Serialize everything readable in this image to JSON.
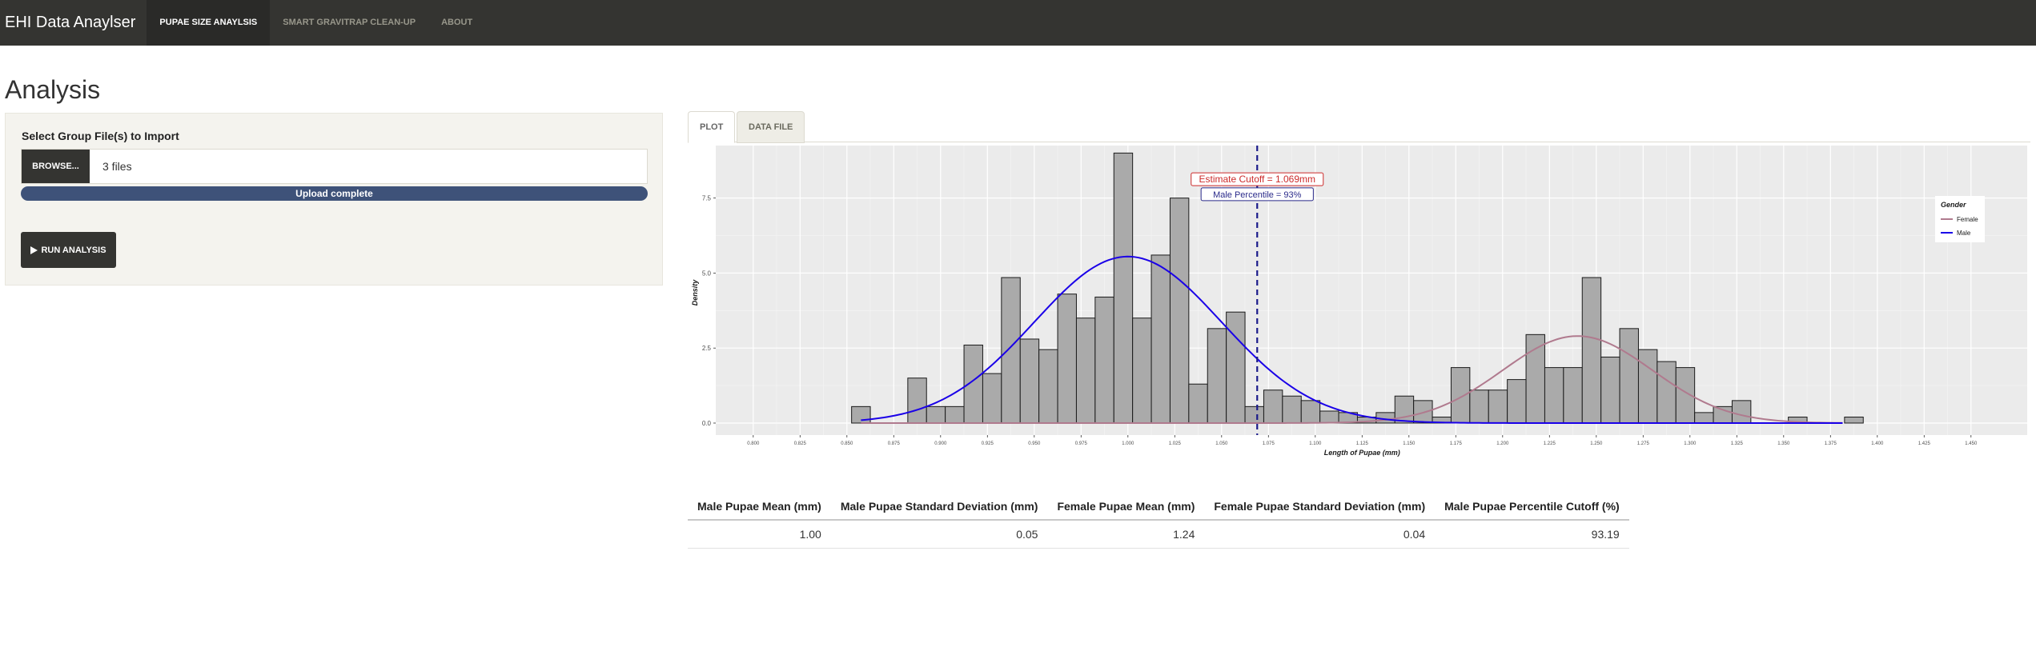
{
  "navbar": {
    "brand": "EHI Data Anaylser",
    "tabs": [
      {
        "label": "PUPAE SIZE ANAYLSIS",
        "active": true
      },
      {
        "label": "SMART GRAVITRAP CLEAN-UP",
        "active": false
      },
      {
        "label": "ABOUT",
        "active": false
      }
    ]
  },
  "page": {
    "title": "Analysis"
  },
  "sidebar": {
    "import_label": "Select Group File(s) to Import",
    "browse_label": "BROWSE...",
    "file_value": "3 files",
    "progress_text": "Upload complete",
    "progress": 1.0,
    "run_label": "RUN ANALYSIS",
    "run_icon": "play-icon"
  },
  "tabs": [
    {
      "label": "PLOT",
      "active": true
    },
    {
      "label": "DATA FILE",
      "active": false
    }
  ],
  "chart_data": {
    "type": "bar",
    "title": "",
    "xlabel": "Length of Pupae (mm)",
    "ylabel": "Density",
    "xlim": [
      0.78,
      1.48
    ],
    "ylim": [
      -0.4,
      9.25
    ],
    "x_ticks": [
      0.8,
      0.825,
      0.85,
      0.875,
      0.9,
      0.925,
      0.95,
      0.975,
      1.0,
      1.025,
      1.05,
      1.075,
      1.1,
      1.125,
      1.15,
      1.175,
      1.2,
      1.225,
      1.25,
      1.275,
      1.3,
      1.325,
      1.35,
      1.375,
      1.4,
      1.425,
      1.45
    ],
    "x_tick_labels": [
      "0.800",
      "0.825",
      "0.850",
      "0.875",
      "0.900",
      "0.925",
      "0.950",
      "0.975",
      "1.000",
      "1.025",
      "1.050",
      "1.075",
      "1.100",
      "1.125",
      "1.150",
      "1.175",
      "1.200",
      "1.225",
      "1.250",
      "1.275",
      "1.300",
      "1.325",
      "1.350",
      "1.375",
      "1.400",
      "1.425",
      "1.450"
    ],
    "y_ticks": [
      0,
      2.5,
      5,
      7.5
    ],
    "y_tick_labels": [
      "0.0",
      "2.5",
      "5.0",
      "7.5"
    ],
    "grid": true,
    "bin_start": 0.8525,
    "bin_width": 0.01,
    "histogram": [
      0.55,
      0,
      0,
      1.5,
      0.55,
      0.55,
      2.6,
      1.65,
      4.85,
      2.8,
      2.45,
      4.3,
      3.5,
      4.2,
      9.0,
      3.5,
      5.6,
      7.5,
      1.3,
      3.15,
      3.7,
      0.55,
      1.1,
      0.9,
      0.75,
      0.4,
      0.35,
      0.2,
      0.35,
      0.9,
      0.75,
      0.2,
      1.85,
      1.1,
      1.1,
      1.45,
      2.95,
      1.85,
      1.85,
      4.85,
      2.2,
      3.15,
      2.45,
      2.05,
      1.85,
      0.35,
      0.55,
      0.75,
      0,
      0,
      0.2,
      0,
      0,
      0.2
    ],
    "series": [
      {
        "name": "Female",
        "color": "#b07a8e",
        "mean": 1.24,
        "sd": 0.04,
        "peak": 2.9,
        "x_range": [
          0.8575,
          1.3825
        ]
      },
      {
        "name": "Male",
        "color": "#1a00e8",
        "mean": 1.0,
        "sd": 0.05,
        "peak": 5.55,
        "x_range": [
          0.8575,
          1.3825
        ]
      }
    ],
    "legend": {
      "title": "Gender",
      "position": "right"
    },
    "cutoff": {
      "x": 1.069,
      "color": "#1a1a8a",
      "style": "dashed"
    },
    "annotations": [
      {
        "text": "Estimate Cutoff = 1.069mm",
        "x": 1.069,
        "y": 8.1,
        "color": "#cc2b2b"
      },
      {
        "text": "Male Percentile = 93%",
        "x": 1.069,
        "y": 7.6,
        "color": "#2a2a8a"
      }
    ]
  },
  "stats_table": {
    "headers": [
      "Male Pupae Mean (mm)",
      "Male Pupae Standard Deviation (mm)",
      "Female Pupae Mean (mm)",
      "Female Pupae Standard Deviation (mm)",
      "Male Pupae Percentile Cutoff (%)"
    ],
    "rows": [
      [
        "1.00",
        "0.05",
        "1.24",
        "0.04",
        "93.19"
      ]
    ]
  }
}
